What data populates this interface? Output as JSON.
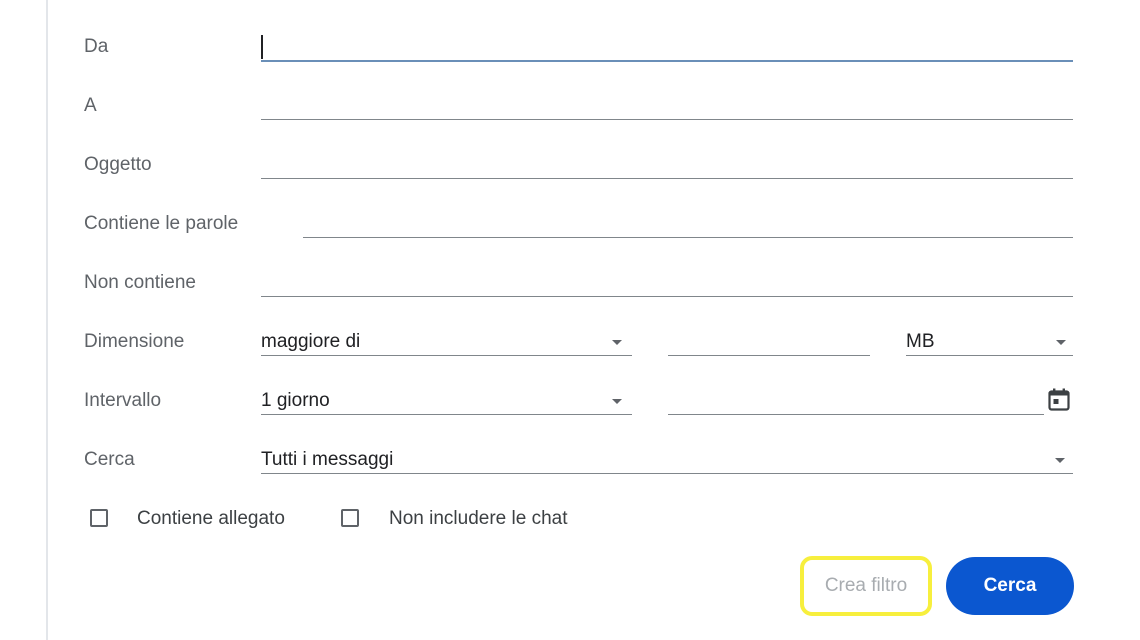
{
  "form": {
    "from_label": "Da",
    "to_label": "A",
    "subject_label": "Oggetto",
    "has_words_label": "Contiene le parole",
    "doesnt_have_label": "Non contiene",
    "size_label": "Dimensione",
    "size_operator_value": "maggiore di",
    "size_unit_value": "MB",
    "date_label": "Intervallo",
    "date_range_value": "1 giorno",
    "search_label": "Cerca",
    "search_scope_value": "Tutti i messaggi",
    "has_attachment_label": "Contiene allegato",
    "exclude_chats_label": "Non includere le chat",
    "create_filter_label": "Crea filtro",
    "search_button_label": "Cerca"
  },
  "colors": {
    "primary": "#0b57d0",
    "highlight": "#f7ef3d",
    "label": "#5f6368"
  },
  "icons": [
    "dropdown-arrow-icon",
    "calendar-icon",
    "checkbox-icon"
  ]
}
